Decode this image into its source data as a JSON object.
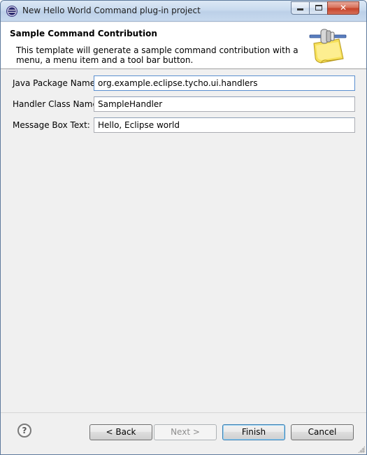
{
  "window": {
    "title": "New Hello World Command plug-in project",
    "minimize_label": "",
    "maximize_label": "",
    "close_label": "✕"
  },
  "header": {
    "title": "Sample Command Contribution",
    "description": "This template will generate a sample command contribution with a menu, a menu item and a tool bar button."
  },
  "form": {
    "java_package": {
      "label": "Java Package Name:",
      "value": "org.example.eclipse.tycho.ui.handlers"
    },
    "handler_class": {
      "label": "Handler Class Name:",
      "value": "SampleHandler"
    },
    "message_box": {
      "label": "Message Box Text:",
      "value": "Hello, Eclipse world"
    }
  },
  "footer": {
    "help_label": "?",
    "back_label": "< Back",
    "next_label": "Next >",
    "finish_label": "Finish",
    "cancel_label": "Cancel"
  },
  "icons": {
    "app": "eclipse-icon",
    "wizard": "plug-folder-icon",
    "help": "help-icon"
  },
  "colors": {
    "titlebar": "#c9daee",
    "close_button": "#c7432a",
    "header_bg": "#ffffff",
    "dialog_bg": "#f0f0f0",
    "default_button_border": "#3c7fb1"
  }
}
